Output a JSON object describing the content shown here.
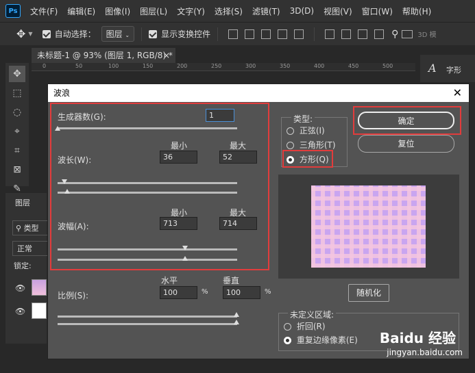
{
  "menubar": {
    "logo": "Ps",
    "items": [
      "文件(F)",
      "编辑(E)",
      "图像(I)",
      "图层(L)",
      "文字(Y)",
      "选择(S)",
      "滤镜(T)",
      "3D(D)",
      "视图(V)",
      "窗口(W)",
      "帮助(H)"
    ]
  },
  "options": {
    "auto_select_label": "自动选择：",
    "auto_select_value": "图层",
    "show_transform_label": "显示变换控件",
    "mode_3d": "3D 模"
  },
  "document": {
    "tab_title": "未标题-1 @ 93% (图层 1, RGB/8) *",
    "ruler_numbers": [
      "0",
      "50",
      "100",
      "150",
      "200",
      "250",
      "300",
      "350",
      "400",
      "450",
      "500"
    ]
  },
  "right_panel": {
    "label": "字形"
  },
  "layers_panel": {
    "title": "图层",
    "kind": "类型",
    "blend": "正常",
    "lock": "锁定:"
  },
  "dialog": {
    "title": "波浪",
    "generators_label": "生成器数(G):",
    "generators_value": "1",
    "wavelength_label": "波长(W):",
    "amplitude_label": "波幅(A):",
    "min_label": "最小",
    "max_label": "最大",
    "wavelength_min": "36",
    "wavelength_max": "52",
    "amplitude_min": "713",
    "amplitude_max": "714",
    "scale_label": "比例(S):",
    "horizontal_label": "水平",
    "vertical_label": "垂直",
    "scale_h": "100",
    "scale_v": "100",
    "percent": "%",
    "type_label": "类型:",
    "type_options": [
      "正弦(I)",
      "三角形(T)",
      "方形(Q)"
    ],
    "selected_type": "方形(Q)",
    "ok_button": "确定",
    "reset_button": "复位",
    "randomize_button": "随机化",
    "undefined_label": "未定义区域:",
    "undefined_options": [
      "折回(R)",
      "重复边缘像素(E)"
    ],
    "selected_undefined": "重复边缘像素(E)"
  },
  "watermark": {
    "brand": "Baidu 经验",
    "url": "jingyan.baidu.com"
  },
  "colors": {
    "highlight": "#e23c3c",
    "preview_a": "#c9a5f0",
    "preview_b": "#f4c6e0"
  }
}
